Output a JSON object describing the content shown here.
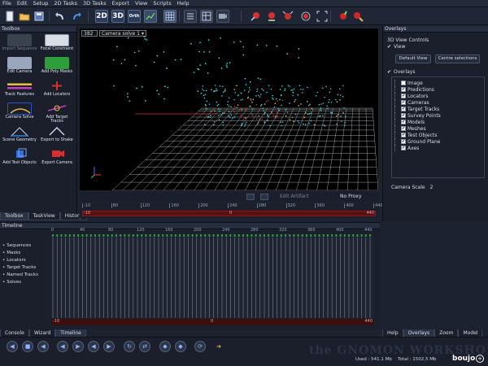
{
  "menu": [
    "File",
    "Edit",
    "Setup",
    "2D Tasks",
    "3D Tasks",
    "Export",
    "View",
    "Scripts",
    "Help"
  ],
  "toolbar": {
    "btn_2d": "2D",
    "btn_3d": "3D",
    "btn_orth": "Orth",
    "toolbar_icons": [
      "new-file-icon",
      "open-folder-icon",
      "save-icon",
      "undo-icon",
      "redo-icon",
      "view-2d-icon",
      "view-3d-icon",
      "orthographic-icon",
      "chart-icon",
      "grid-icon",
      "list-icon",
      "table-icon",
      "camera-solve-icon",
      "tracker-icon",
      "paint-icon",
      "fullscreen-icon",
      "zoom-icon",
      "search-icon"
    ]
  },
  "toolbox": {
    "title": "Toolbox",
    "tools": [
      {
        "label": "Import Sequence",
        "disabled": true
      },
      {
        "label": "Focal Constraint",
        "disabled": false
      },
      {
        "label": "Edit Camera",
        "disabled": false
      },
      {
        "label": "Add Poly Masks",
        "disabled": false
      },
      {
        "label": "Track Features",
        "disabled": false
      },
      {
        "label": "Add Locators",
        "disabled": false
      },
      {
        "label": "Camera Solve",
        "disabled": false
      },
      {
        "label": "Add Target Tracks",
        "disabled": false
      },
      {
        "label": "Scene Geometry",
        "disabled": false
      },
      {
        "label": "Export to Shake",
        "disabled": false
      },
      {
        "label": "Add Test Objects",
        "disabled": false
      },
      {
        "label": "Export Camera",
        "disabled": false
      }
    ],
    "tabs": [
      "Toolbox",
      "TaskView",
      "History"
    ]
  },
  "viewport": {
    "frame_number": "382",
    "camera_select": "Camera solve 1",
    "edit_artifact": "Edit Artifact",
    "proxy": "No Proxy",
    "ruler_ticks": [
      "-10",
      "80",
      "120",
      "160",
      "200",
      "240",
      "280",
      "320",
      "360",
      "400",
      "440"
    ],
    "range_start": "-10",
    "range_end": "440",
    "current_frame": "0"
  },
  "overlays": {
    "title": "Overlays",
    "view_controls_label": "3D View Controls",
    "view_checkbox": "View",
    "default_view_button": "Default View",
    "centre_selections_button": "Centre selections",
    "overlays_group": "Overlays",
    "items": [
      {
        "label": "Image",
        "checked": false
      },
      {
        "label": "Predictions",
        "checked": true
      },
      {
        "label": "Locators",
        "checked": true
      },
      {
        "label": "Cameras",
        "checked": true
      },
      {
        "label": "Target Tracks",
        "checked": true
      },
      {
        "label": "Survey Points",
        "checked": true
      },
      {
        "label": "Models",
        "checked": true
      },
      {
        "label": "Meshes",
        "checked": true
      },
      {
        "label": "Test Objects",
        "checked": true
      },
      {
        "label": "Ground Plane",
        "checked": true
      },
      {
        "label": "Axes",
        "checked": true
      }
    ],
    "camera_scale_label": "Camera Scale",
    "camera_scale_value": "2",
    "tabs": [
      "Help",
      "Overlays",
      "Zoom",
      "Model"
    ]
  },
  "timeline": {
    "title": "Timeline",
    "items": [
      "Sequences",
      "Masks",
      "Locators",
      "Target Tracks",
      "Named Tracks",
      "Solves"
    ],
    "ruler_ticks": [
      "0",
      "40",
      "80",
      "120",
      "160",
      "200",
      "240",
      "280",
      "320",
      "360",
      "400",
      "440"
    ],
    "range_start": "-10",
    "range_end": "440",
    "current_frame": "0"
  },
  "bottom_tabs": [
    "Console",
    "Wizard",
    "Timeline"
  ],
  "status": {
    "used": "Used : 541.1 Mb",
    "total": "Total : 1502.5 Mb",
    "brand": "boujo",
    "watermark": "the GNOMON WORKSHOP"
  },
  "colors": {
    "accent_green": "#2e9e3a",
    "scrub_red": "#8a1a1a",
    "point_cyan": "#3ad0d8"
  }
}
